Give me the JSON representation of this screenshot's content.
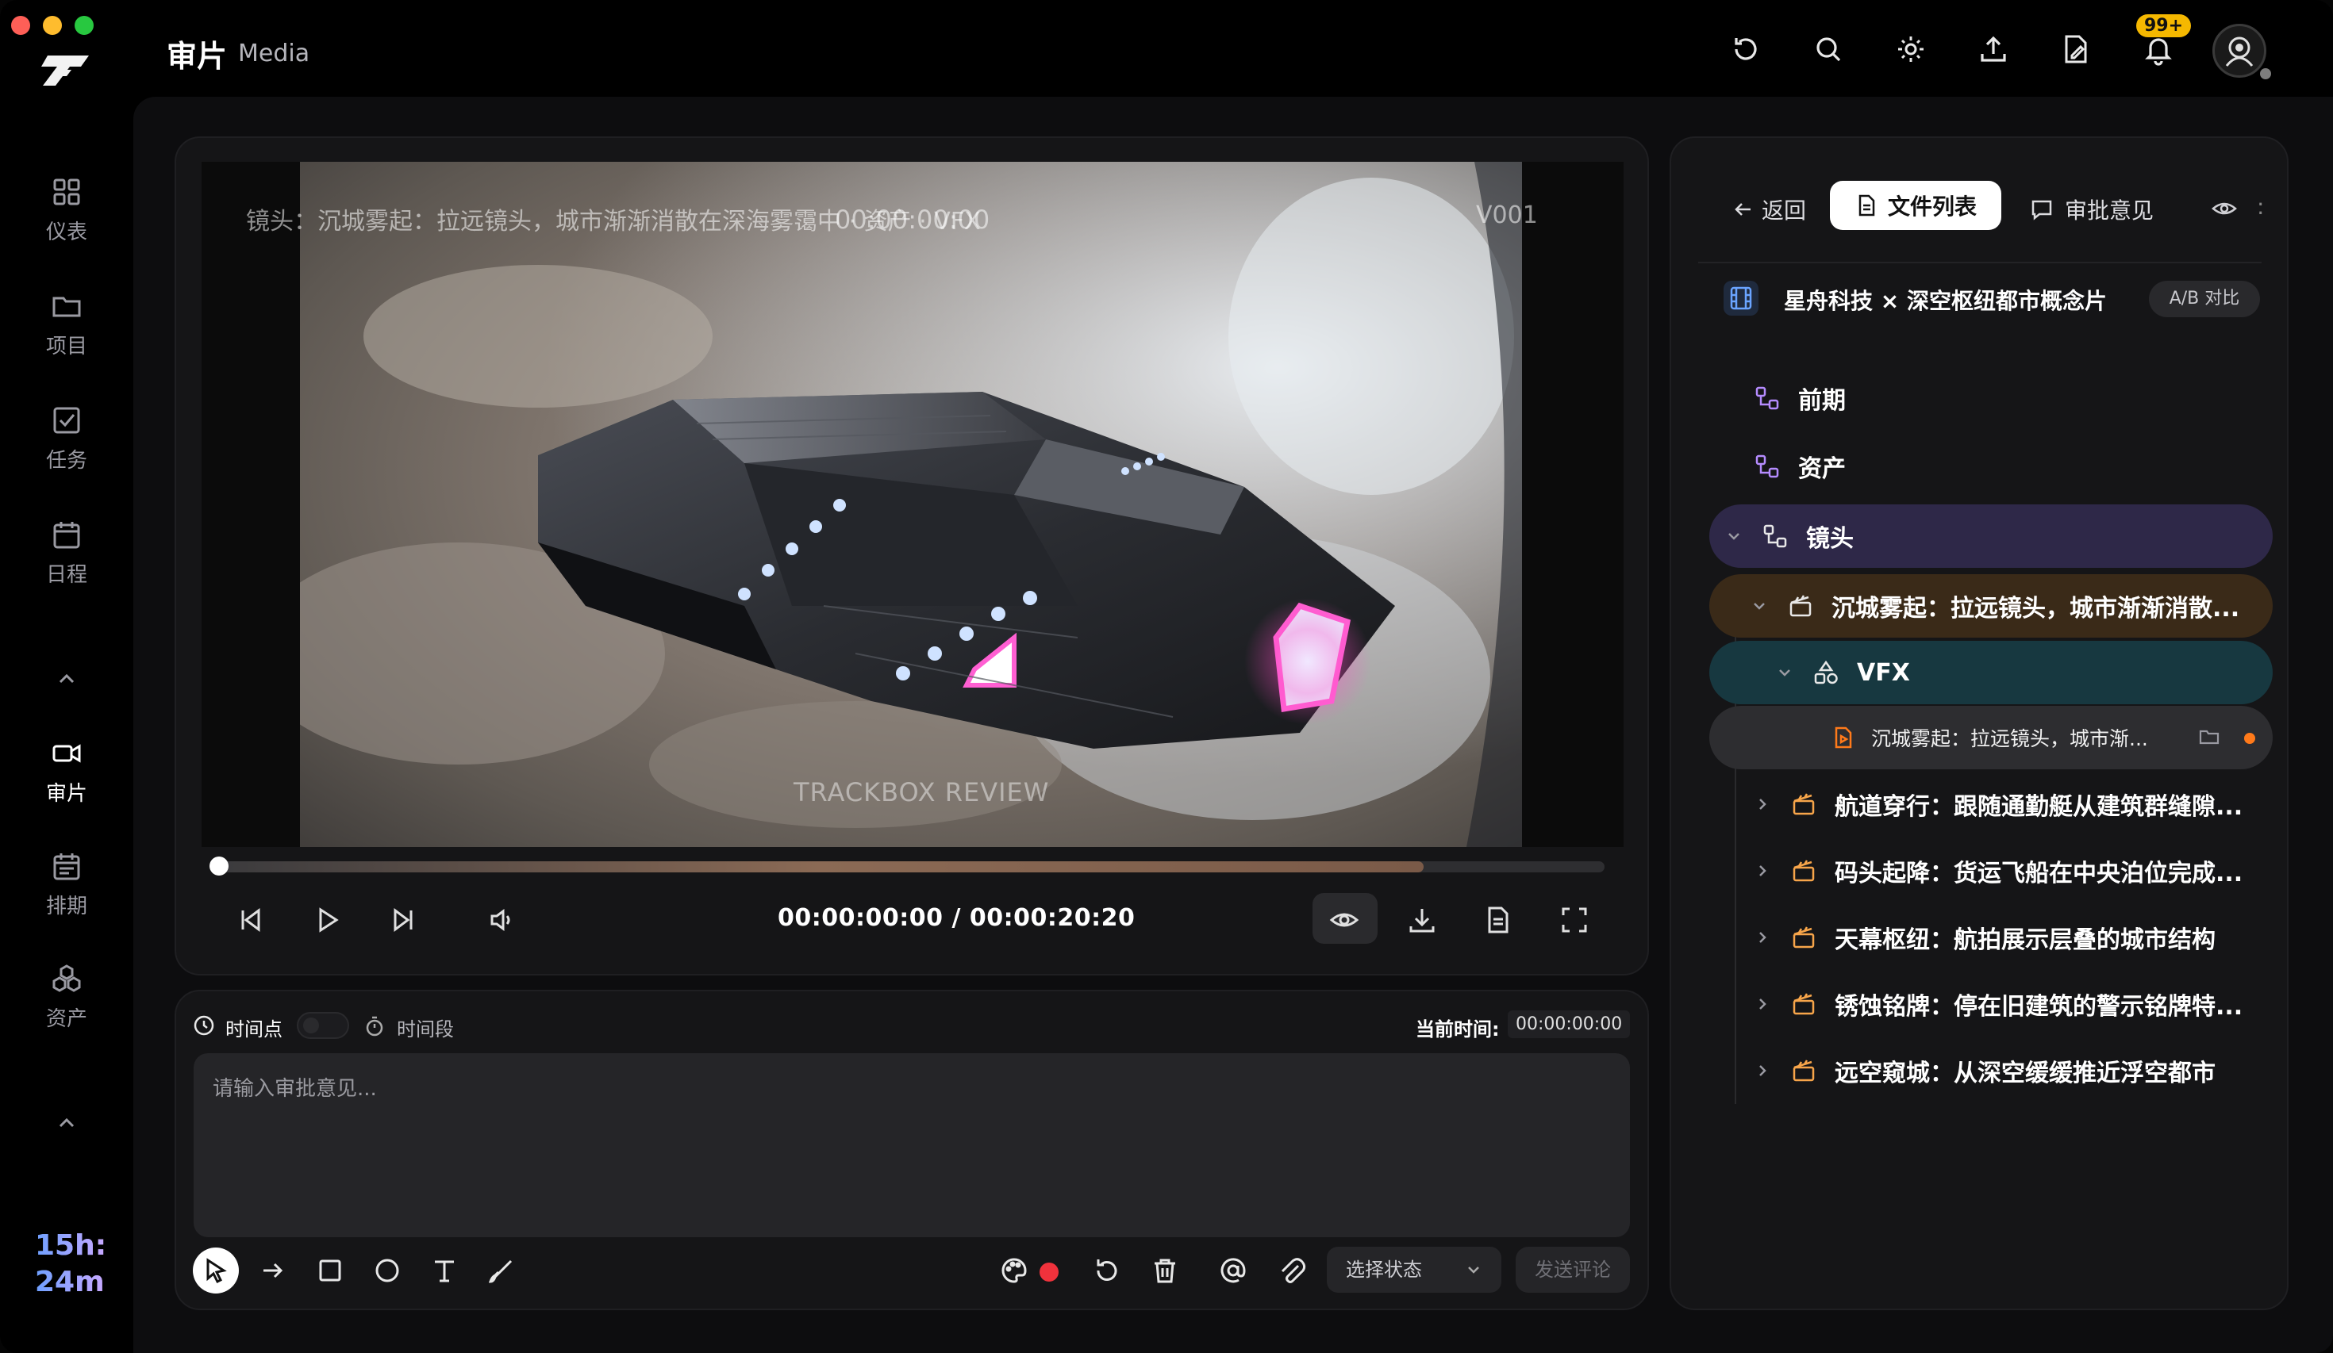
{
  "header": {
    "title": "审片",
    "subtitle": "Media",
    "notification_badge": "99+"
  },
  "sidebar": {
    "items": [
      {
        "label": "仪表",
        "icon": "grid-icon"
      },
      {
        "label": "项目",
        "icon": "folder-icon"
      },
      {
        "label": "任务",
        "icon": "checkbox-icon"
      },
      {
        "label": "日程",
        "icon": "calendar-icon"
      },
      {
        "label": "审片",
        "icon": "video-camera-icon",
        "active": true
      },
      {
        "label": "排期",
        "icon": "schedule-icon"
      },
      {
        "label": "资产",
        "icon": "assets-icon"
      }
    ],
    "timer_hours": "15h:",
    "timer_minutes": "24m"
  },
  "player": {
    "watermark_top": "镜头：沉城雾起：拉远镜头，城市渐渐消散在深海雾霭中 · 资产 · VFX",
    "watermark_timecode": "00:00:00:00",
    "watermark_code": "V001",
    "watermark_center": "TRACKBOX REVIEW",
    "progress_played": 0.0,
    "progress_buffered": 0.87,
    "current_time": "00:00:00:00",
    "separator": "/",
    "total_time": "00:00:20:20"
  },
  "comment": {
    "timepoint_label": "时间点",
    "timerange_label": "时间段",
    "current_time_label": "当前时间:",
    "current_time_value": "00:00:00:00",
    "placeholder": "请输入审批意见...",
    "status_placeholder": "选择状态",
    "send_label": "发送评论",
    "color_current": "#f0323c"
  },
  "right_panel": {
    "back_label": "返回",
    "tab_files": "文件列表",
    "tab_review": "审批意见",
    "more": ":",
    "project_title": "星舟科技 × 深空枢纽都市概念片",
    "ab_compare": "A/B 对比",
    "tree": {
      "pre": "前期",
      "assets": "资产",
      "shots": "镜头",
      "shot_active": "沉城雾起：拉远镜头，城市渐渐消散...",
      "vfx": "VFX",
      "file_active": "沉城雾起：拉远镜头，城市渐...",
      "shots_other": [
        "航道穿行：跟随通勤艇从建筑群缝隙...",
        "码头起降：货运飞船在中央泊位完成...",
        "天幕枢纽：航拍展示层叠的城市结构",
        "锈蚀铭牌：停在旧建筑的警示铭牌特...",
        "远空窥城：从深空缓缓推近浮空都市"
      ]
    }
  },
  "colors": {
    "accent_orange": "#ff7a1a",
    "clapper_orange": "#f7a54a",
    "highlight_purple": "#2e2848",
    "highlight_brown": "#3a2a18",
    "highlight_teal": "#173840",
    "pipeline_purple": "#b58cff"
  }
}
